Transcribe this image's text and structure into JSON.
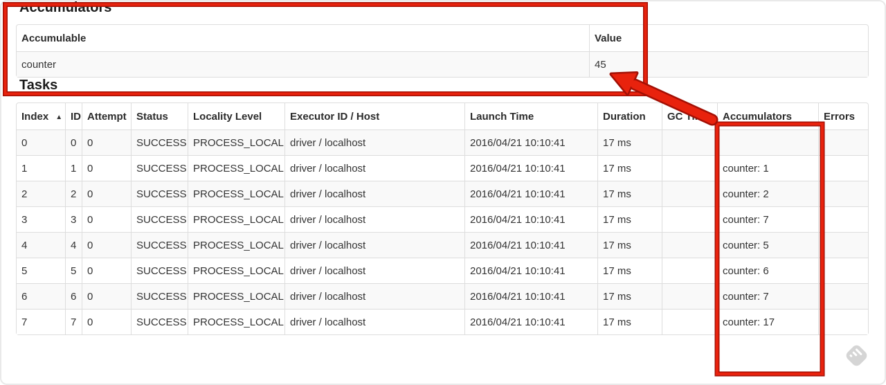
{
  "annotations": {
    "red": "#e8220d",
    "red_dark": "#a31005"
  },
  "accumulators_section": {
    "title": "Accumulators",
    "headers": [
      "Accumulable",
      "Value"
    ],
    "rows": [
      [
        "counter",
        "45"
      ]
    ]
  },
  "tasks_section": {
    "title": "Tasks",
    "sort_caret": "▲",
    "headers": [
      "Index",
      "ID",
      "Attempt",
      "Status",
      "Locality Level",
      "Executor ID / Host",
      "Launch Time",
      "Duration",
      "GC Time",
      "Accumulators",
      "Errors"
    ],
    "rows": [
      [
        "0",
        "0",
        "0",
        "SUCCESS",
        "PROCESS_LOCAL",
        "driver / localhost",
        "2016/04/21 10:10:41",
        "17 ms",
        "",
        "",
        ""
      ],
      [
        "1",
        "1",
        "0",
        "SUCCESS",
        "PROCESS_LOCAL",
        "driver / localhost",
        "2016/04/21 10:10:41",
        "17 ms",
        "",
        "counter: 1",
        ""
      ],
      [
        "2",
        "2",
        "0",
        "SUCCESS",
        "PROCESS_LOCAL",
        "driver / localhost",
        "2016/04/21 10:10:41",
        "17 ms",
        "",
        "counter: 2",
        ""
      ],
      [
        "3",
        "3",
        "0",
        "SUCCESS",
        "PROCESS_LOCAL",
        "driver / localhost",
        "2016/04/21 10:10:41",
        "17 ms",
        "",
        "counter: 7",
        ""
      ],
      [
        "4",
        "4",
        "0",
        "SUCCESS",
        "PROCESS_LOCAL",
        "driver / localhost",
        "2016/04/21 10:10:41",
        "17 ms",
        "",
        "counter: 5",
        ""
      ],
      [
        "5",
        "5",
        "0",
        "SUCCESS",
        "PROCESS_LOCAL",
        "driver / localhost",
        "2016/04/21 10:10:41",
        "17 ms",
        "",
        "counter: 6",
        ""
      ],
      [
        "6",
        "6",
        "0",
        "SUCCESS",
        "PROCESS_LOCAL",
        "driver / localhost",
        "2016/04/21 10:10:41",
        "17 ms",
        "",
        "counter: 7",
        ""
      ],
      [
        "7",
        "7",
        "0",
        "SUCCESS",
        "PROCESS_LOCAL",
        "driver / localhost",
        "2016/04/21 10:10:41",
        "17 ms",
        "",
        "counter: 17",
        ""
      ]
    ]
  }
}
